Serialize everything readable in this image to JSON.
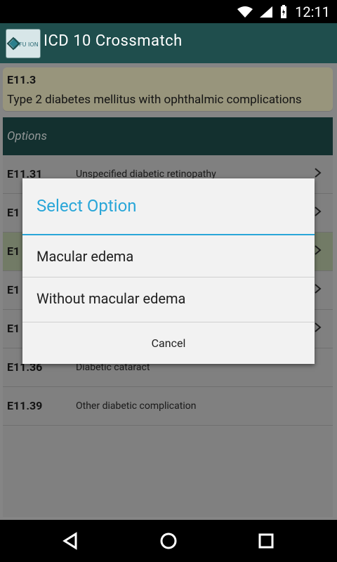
{
  "status_bar": {
    "time": "12:11"
  },
  "app_bar": {
    "logo_text": "FU ION",
    "title": "ICD 10 Crossmatch"
  },
  "header_card": {
    "code": "E11.3",
    "description": "Type 2 diabetes mellitus with ophthalmic complications"
  },
  "options_header": {
    "label": "Options"
  },
  "list": {
    "rows": [
      {
        "code": "E11.31",
        "description": "Unspecified diabetic retinopathy",
        "has_chevron": true
      },
      {
        "code": "E1",
        "description": "",
        "has_chevron": true
      },
      {
        "code": "E1",
        "description": "",
        "has_chevron": true
      },
      {
        "code": "E1",
        "description": "",
        "has_chevron": true
      },
      {
        "code": "E1",
        "description": "",
        "has_chevron": true
      },
      {
        "code": "E11.36",
        "description": "Diabetic cataract",
        "has_chevron": false
      },
      {
        "code": "E11.39",
        "description": "Other diabetic complication",
        "has_chevron": false
      }
    ]
  },
  "dialog": {
    "title": "Select Option",
    "options": [
      {
        "label": "Macular edema"
      },
      {
        "label": "Without macular edema"
      }
    ],
    "cancel_label": "Cancel"
  },
  "colors": {
    "app_bar": "#1f4e4d",
    "dialog_accent": "#29a6d8",
    "header_card_bg": "#f5f0c8",
    "selected_row_bg": "#b8c7a5"
  }
}
